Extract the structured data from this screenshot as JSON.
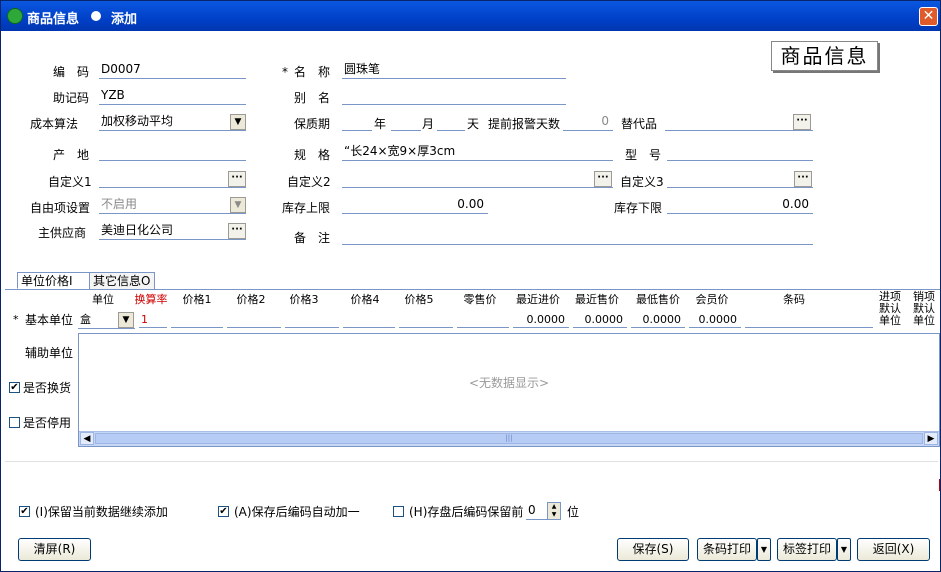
{
  "window": {
    "title": "商品信息",
    "mode": "添加"
  },
  "stamp": "商品信息",
  "form": {
    "code": {
      "label": "编　码",
      "value": "D0007"
    },
    "name": {
      "label": "名　称",
      "required_mark": "*",
      "value": "圆珠笔"
    },
    "mnemonic": {
      "label": "助记码",
      "value": "YZB"
    },
    "alias": {
      "label": "别　名",
      "value": ""
    },
    "cost_method": {
      "label": "成本算法",
      "value": "加权移动平均"
    },
    "shelf_life": {
      "label": "保质期",
      "year": "年",
      "month": "月",
      "day": "天"
    },
    "alert_days": {
      "label": "提前报警天数",
      "value": "0"
    },
    "substitute": {
      "label": "替代品",
      "value": ""
    },
    "origin": {
      "label": "产　地",
      "value": ""
    },
    "spec": {
      "label": "规　格",
      "value": "“长24×宽9×厚3cm"
    },
    "model": {
      "label": "型　号",
      "value": ""
    },
    "custom1": {
      "label": "自定义1",
      "value": ""
    },
    "custom2": {
      "label": "自定义2",
      "value": ""
    },
    "custom3": {
      "label": "自定义3",
      "value": ""
    },
    "free_item": {
      "label": "自由项设置",
      "value": "不启用"
    },
    "stock_upper": {
      "label": "库存上限",
      "value": "0.00"
    },
    "stock_lower": {
      "label": "库存下限",
      "value": "0.00"
    },
    "supplier": {
      "label": "主供应商",
      "value": "美迪日化公司"
    },
    "remark": {
      "label": "备　注",
      "value": ""
    }
  },
  "tabs": [
    {
      "label": "单位价格I"
    },
    {
      "label": "其它信息O"
    }
  ],
  "price_table": {
    "headers": [
      "单位",
      "换算率",
      "价格1",
      "价格2",
      "价格3",
      "价格4",
      "价格5",
      "零售价",
      "最近进价",
      "最近售价",
      "最低售价",
      "会员价",
      "条码"
    ],
    "header_in_default": [
      "进项",
      "默认",
      "单位"
    ],
    "header_out_default": [
      "销项",
      "默认",
      "单位"
    ],
    "base_unit": {
      "label": "基本单位",
      "required_mark": "*",
      "unit": "盒",
      "rate": "1",
      "last_in": "0.0000",
      "last_out": "0.0000",
      "min_price": "0.0000",
      "member_price": "0.0000"
    },
    "aux_unit_label": "辅助单位",
    "no_data": "<无数据显示>"
  },
  "side_checks": {
    "exchange": {
      "label": "是否换货",
      "checked": true
    },
    "disabled": {
      "label": "是否停用",
      "checked": false
    }
  },
  "options": {
    "keep_data": {
      "label": "(I)保留当前数据继续添加",
      "checked": true
    },
    "auto_inc": {
      "label": "(A)保存后编码自动加一",
      "checked": true
    },
    "keep_code": {
      "label": "(H)存盘后编码保留前",
      "checked": false,
      "value": "0",
      "suffix": "位"
    }
  },
  "buttons": {
    "clear": "清屏(R)",
    "save": "保存(S)",
    "barcode": "条码打印",
    "label": "标签打印",
    "back": "返回(X)"
  }
}
